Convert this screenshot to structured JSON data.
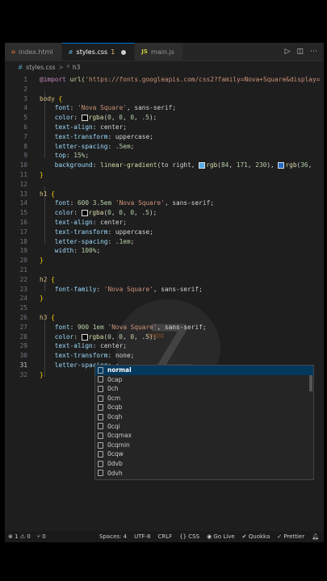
{
  "tabs": [
    {
      "icon": "html-icon",
      "label": "index.html",
      "modified": "",
      "active": false
    },
    {
      "icon": "css-icon",
      "label": "styles.css",
      "modified": "1",
      "active": true
    },
    {
      "icon": "js-icon",
      "label": "main.js",
      "modified": "",
      "active": false
    }
  ],
  "tab_icons": {
    "html": "⌂",
    "css": "#",
    "js": "JS"
  },
  "breadcrumb": {
    "file": "styles.css",
    "separator": ">",
    "symbol_icon": "⁰",
    "symbol": "h3"
  },
  "editor": {
    "lines": [
      {
        "n": "1",
        "parts": [
          [
            "kw",
            "@import "
          ],
          [
            "fn",
            "url("
          ],
          [
            "str",
            "'https://fonts.googleapis.com/css2?family=Nova+Square&display="
          ]
        ]
      },
      {
        "n": "2",
        "parts": []
      },
      {
        "n": "3",
        "parts": [
          [
            "sel",
            "body "
          ],
          [
            "brace",
            "{"
          ]
        ]
      },
      {
        "n": "4",
        "parts": [
          [
            "",
            "    "
          ],
          [
            "prop",
            "font"
          ],
          [
            "",
            ": "
          ],
          [
            "str",
            "'Nova Square'"
          ],
          [
            "",
            ", sans-serif;"
          ]
        ]
      },
      {
        "n": "5",
        "parts": [
          [
            "",
            "    "
          ],
          [
            "prop",
            "color"
          ],
          [
            "",
            ": "
          ],
          [
            "swatch",
            ""
          ],
          [
            "fn",
            "rgba"
          ],
          [
            "",
            "("
          ],
          [
            "num",
            "0"
          ],
          [
            "",
            ", "
          ],
          [
            "num",
            "0"
          ],
          [
            "",
            ", "
          ],
          [
            "num",
            "0"
          ],
          [
            "",
            ", "
          ],
          [
            "num",
            ".5"
          ],
          [
            "",
            ");"
          ]
        ]
      },
      {
        "n": "6",
        "parts": [
          [
            "",
            "    "
          ],
          [
            "prop",
            "text-align"
          ],
          [
            "",
            ": center;"
          ]
        ]
      },
      {
        "n": "7",
        "parts": [
          [
            "",
            "    "
          ],
          [
            "prop",
            "text-transform"
          ],
          [
            "",
            ": uppercase;"
          ]
        ]
      },
      {
        "n": "8",
        "parts": [
          [
            "",
            "    "
          ],
          [
            "prop",
            "letter-spacing"
          ],
          [
            "",
            ": "
          ],
          [
            "num",
            ".5em"
          ],
          [
            "",
            ";"
          ]
        ]
      },
      {
        "n": "9",
        "parts": [
          [
            "",
            "    "
          ],
          [
            "prop",
            "top"
          ],
          [
            "",
            ": "
          ],
          [
            "num",
            "15%"
          ],
          [
            "",
            ";"
          ]
        ]
      },
      {
        "n": "10",
        "parts": [
          [
            "",
            "    "
          ],
          [
            "prop",
            "background"
          ],
          [
            "",
            ": "
          ],
          [
            "fn",
            "linear-gradient"
          ],
          [
            "",
            "(to right, "
          ],
          [
            "swatch2",
            ""
          ],
          [
            "fn",
            "rgb"
          ],
          [
            "",
            "("
          ],
          [
            "num",
            "84"
          ],
          [
            "",
            ", "
          ],
          [
            "num",
            "171"
          ],
          [
            "",
            ", "
          ],
          [
            "num",
            "230"
          ],
          [
            "",
            "), "
          ],
          [
            "swatch3",
            ""
          ],
          [
            "fn",
            "rgb"
          ],
          [
            "",
            "("
          ],
          [
            "num",
            "36"
          ],
          [
            "",
            ", "
          ]
        ]
      },
      {
        "n": "11",
        "parts": [
          [
            "brace",
            "}"
          ]
        ]
      },
      {
        "n": "12",
        "parts": []
      },
      {
        "n": "13",
        "parts": [
          [
            "sel",
            "h1 "
          ],
          [
            "brace",
            "{"
          ]
        ]
      },
      {
        "n": "14",
        "parts": [
          [
            "",
            "    "
          ],
          [
            "prop",
            "font"
          ],
          [
            "",
            ": "
          ],
          [
            "num",
            "600 3.5em "
          ],
          [
            "str",
            "'Nova Square'"
          ],
          [
            "",
            ", sans-serif;"
          ]
        ]
      },
      {
        "n": "15",
        "parts": [
          [
            "",
            "    "
          ],
          [
            "prop",
            "color"
          ],
          [
            "",
            ": "
          ],
          [
            "swatch",
            ""
          ],
          [
            "fn",
            "rgba"
          ],
          [
            "",
            "("
          ],
          [
            "num",
            "0"
          ],
          [
            "",
            ", "
          ],
          [
            "num",
            "0"
          ],
          [
            "",
            ", "
          ],
          [
            "num",
            "0"
          ],
          [
            "",
            ", "
          ],
          [
            "num",
            ".5"
          ],
          [
            "",
            ");"
          ]
        ]
      },
      {
        "n": "16",
        "parts": [
          [
            "",
            "    "
          ],
          [
            "prop",
            "text-align"
          ],
          [
            "",
            ": center;"
          ]
        ]
      },
      {
        "n": "17",
        "parts": [
          [
            "",
            "    "
          ],
          [
            "prop",
            "text-transform"
          ],
          [
            "",
            ": uppercase;"
          ]
        ]
      },
      {
        "n": "18",
        "parts": [
          [
            "",
            "    "
          ],
          [
            "prop",
            "letter-spacing"
          ],
          [
            "",
            ": "
          ],
          [
            "num",
            ".1em"
          ],
          [
            "",
            ";"
          ]
        ]
      },
      {
        "n": "19",
        "parts": [
          [
            "",
            "    "
          ],
          [
            "prop",
            "width"
          ],
          [
            "",
            ": "
          ],
          [
            "num",
            "100%"
          ],
          [
            "",
            ";"
          ]
        ]
      },
      {
        "n": "20",
        "parts": [
          [
            "brace",
            "}"
          ]
        ]
      },
      {
        "n": "21",
        "parts": []
      },
      {
        "n": "22",
        "parts": [
          [
            "sel",
            "h2 "
          ],
          [
            "brace",
            "{"
          ]
        ]
      },
      {
        "n": "23",
        "parts": [
          [
            "",
            "    "
          ],
          [
            "prop",
            "font-family"
          ],
          [
            "",
            ": "
          ],
          [
            "str",
            "'Nova Square'"
          ],
          [
            "",
            ", sans-serif;"
          ]
        ]
      },
      {
        "n": "24",
        "parts": [
          [
            "brace",
            "}"
          ]
        ]
      },
      {
        "n": "25",
        "parts": []
      },
      {
        "n": "26",
        "parts": [
          [
            "sel",
            "h3 "
          ],
          [
            "brace",
            "{"
          ]
        ]
      },
      {
        "n": "27",
        "parts": [
          [
            "",
            "    "
          ],
          [
            "prop",
            "font"
          ],
          [
            "",
            ": "
          ],
          [
            "num",
            "900 1em "
          ],
          [
            "str",
            "'Nova Square'"
          ],
          [
            "",
            ", sans-serif;"
          ]
        ]
      },
      {
        "n": "28",
        "parts": [
          [
            "",
            "    "
          ],
          [
            "prop",
            "color"
          ],
          [
            "",
            ": "
          ],
          [
            "swatch",
            ""
          ],
          [
            "fn",
            "rgba"
          ],
          [
            "",
            "("
          ],
          [
            "num",
            "0"
          ],
          [
            "",
            ", "
          ],
          [
            "num",
            "0"
          ],
          [
            "",
            ", "
          ],
          [
            "num",
            "0"
          ],
          [
            "",
            ", "
          ],
          [
            "num",
            ".5"
          ],
          [
            "",
            ");"
          ]
        ]
      },
      {
        "n": "29",
        "parts": [
          [
            "",
            "    "
          ],
          [
            "prop",
            "text-align"
          ],
          [
            "",
            ": center;"
          ]
        ]
      },
      {
        "n": "30",
        "parts": [
          [
            "",
            "    "
          ],
          [
            "prop",
            "text-transform"
          ],
          [
            "",
            ": none;"
          ]
        ]
      },
      {
        "n": "31",
        "parts": [
          [
            "",
            "    "
          ],
          [
            "prop",
            "letter-spacing"
          ],
          [
            "",
            ": ;"
          ]
        ],
        "current": true
      },
      {
        "n": "32",
        "parts": [
          [
            "brace",
            "}"
          ]
        ]
      }
    ]
  },
  "swatch_colors": {
    "swatch": "#000000",
    "swatch2": "#54abe6",
    "swatch3": "#2468c8"
  },
  "suggestions": {
    "items": [
      "normal",
      "0cap",
      "0ch",
      "0cm",
      "0cqb",
      "0cqh",
      "0cqi",
      "0cqmax",
      "0cqmin",
      "0cqw",
      "0dvb",
      "0dvh"
    ],
    "selected_index": 0
  },
  "status": {
    "errors": "1",
    "warnings": "0",
    "ports": "0",
    "spaces": "Spaces: 4",
    "encoding": "UTF-8",
    "eol": "CRLF",
    "language": "CSS",
    "golive": "Go Live",
    "quokka": "Quokka",
    "prettier": "Prettier"
  }
}
